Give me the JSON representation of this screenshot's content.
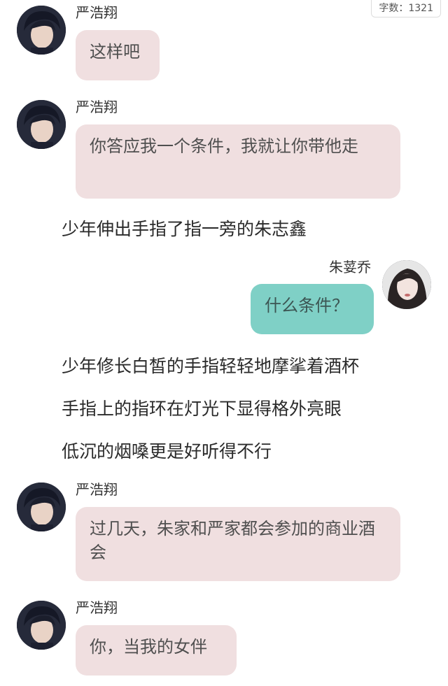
{
  "word_count": "字数：1321",
  "messages": [
    {
      "sender": "严浩翔",
      "text": "这样吧"
    },
    {
      "sender": "严浩翔",
      "text": "你答应我一个条件，我就让你带他走"
    },
    {
      "sender": "朱荽乔",
      "text": "什么条件？"
    },
    {
      "sender": "严浩翔",
      "text": "过几天，朱家和严家都会参加的商业酒会"
    },
    {
      "sender": "严浩翔",
      "text": "你，当我的女伴"
    }
  ],
  "narration": [
    "少年伸出手指了指一旁的朱志鑫",
    "少年修长白皙的手指轻轻地摩挲着酒杯",
    "手指上的指环在灯光下显得格外亮眼",
    "低沉的烟嗓更是好听得不行"
  ]
}
